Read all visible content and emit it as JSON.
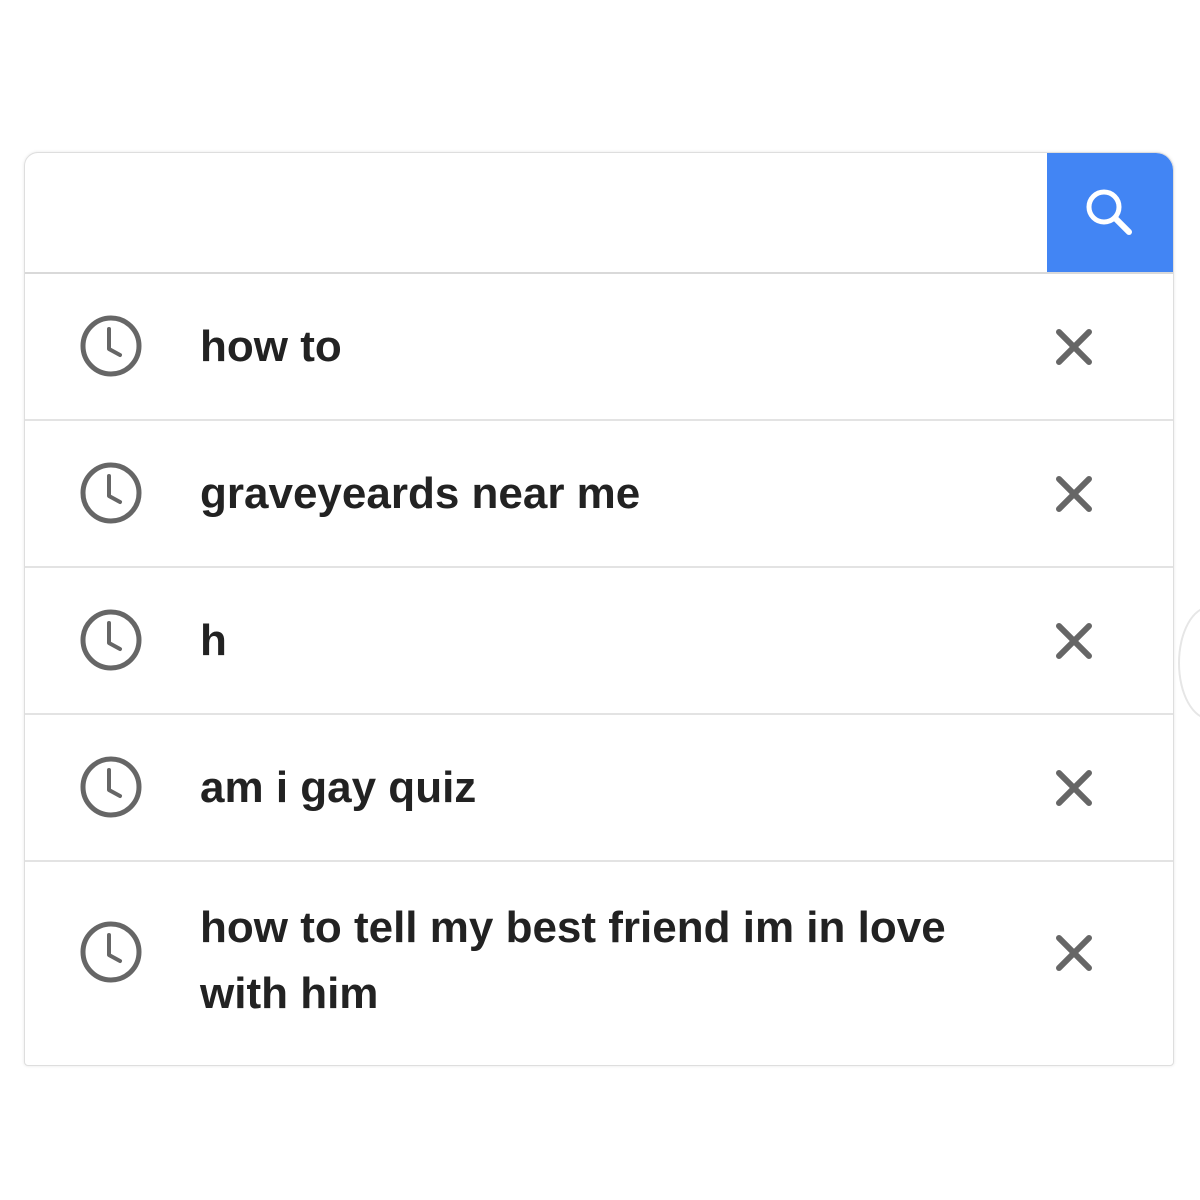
{
  "search": {
    "value": "",
    "placeholder": ""
  },
  "colors": {
    "accent": "#4285f4",
    "text": "#222222",
    "icon": "#666666"
  },
  "icons": {
    "search_button": "search-icon",
    "history": "clock-icon",
    "remove": "close-icon"
  },
  "history": [
    {
      "text": "how to"
    },
    {
      "text": "graveyeards near me"
    },
    {
      "text": "h"
    },
    {
      "text": "am i gay quiz"
    },
    {
      "text": "how to tell my best friend im in love with him"
    }
  ]
}
